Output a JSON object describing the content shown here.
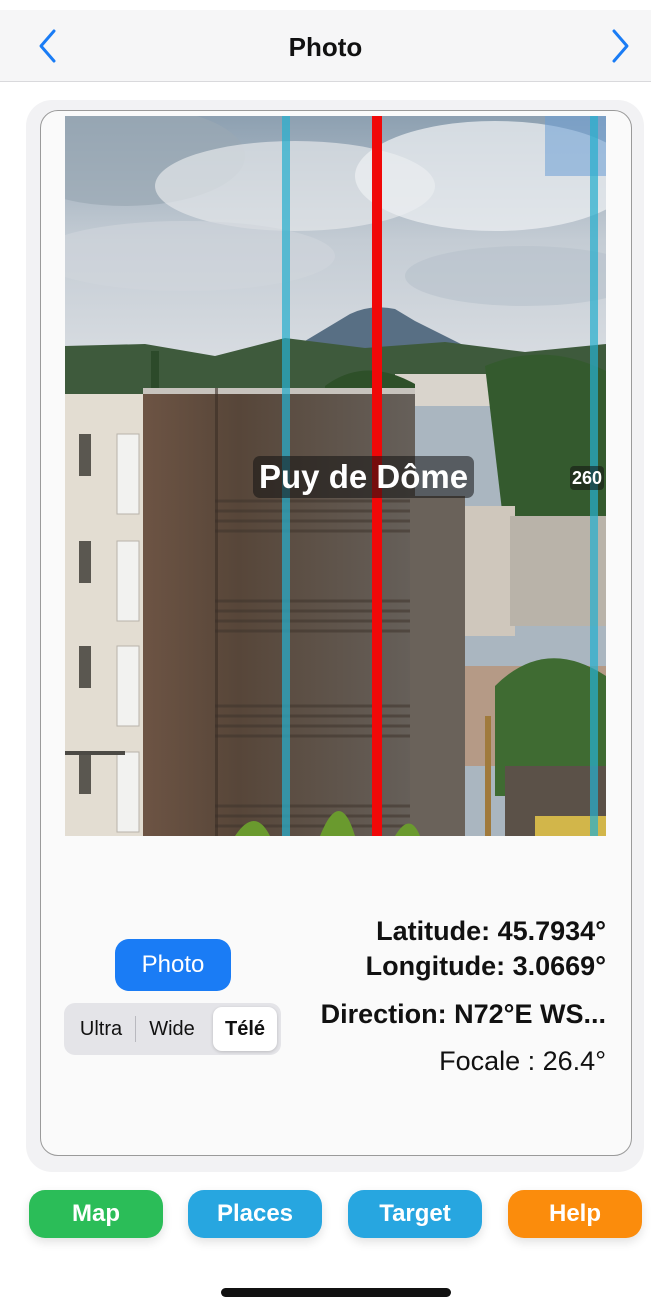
{
  "navbar": {
    "title": "Photo",
    "back_icon": "chevron-left-icon",
    "forward_icon": "chevron-right-icon",
    "accent": "#1a7cf5"
  },
  "photo": {
    "peak_label": "Puy de Dôme",
    "bearing_label": "260",
    "center_line_color": "#f00808",
    "side_line_color": "#28afcd"
  },
  "info": {
    "latitude": "Latitude: 45.7934°",
    "longitude": "Longitude: 3.0669°",
    "direction": "Direction: N72°E  WS...",
    "focal": "Focale : 26.4°"
  },
  "controls": {
    "photo_button": "Photo",
    "lens_options": [
      "Ultra",
      "Wide",
      "Télé"
    ],
    "selected_lens": "Télé"
  },
  "tabs": [
    {
      "label": "Map",
      "color": "#2bbd58"
    },
    {
      "label": "Places",
      "color": "#27a6e0"
    },
    {
      "label": "Target",
      "color": "#27a6e0"
    },
    {
      "label": "Help",
      "color": "#fb8c0c"
    }
  ]
}
